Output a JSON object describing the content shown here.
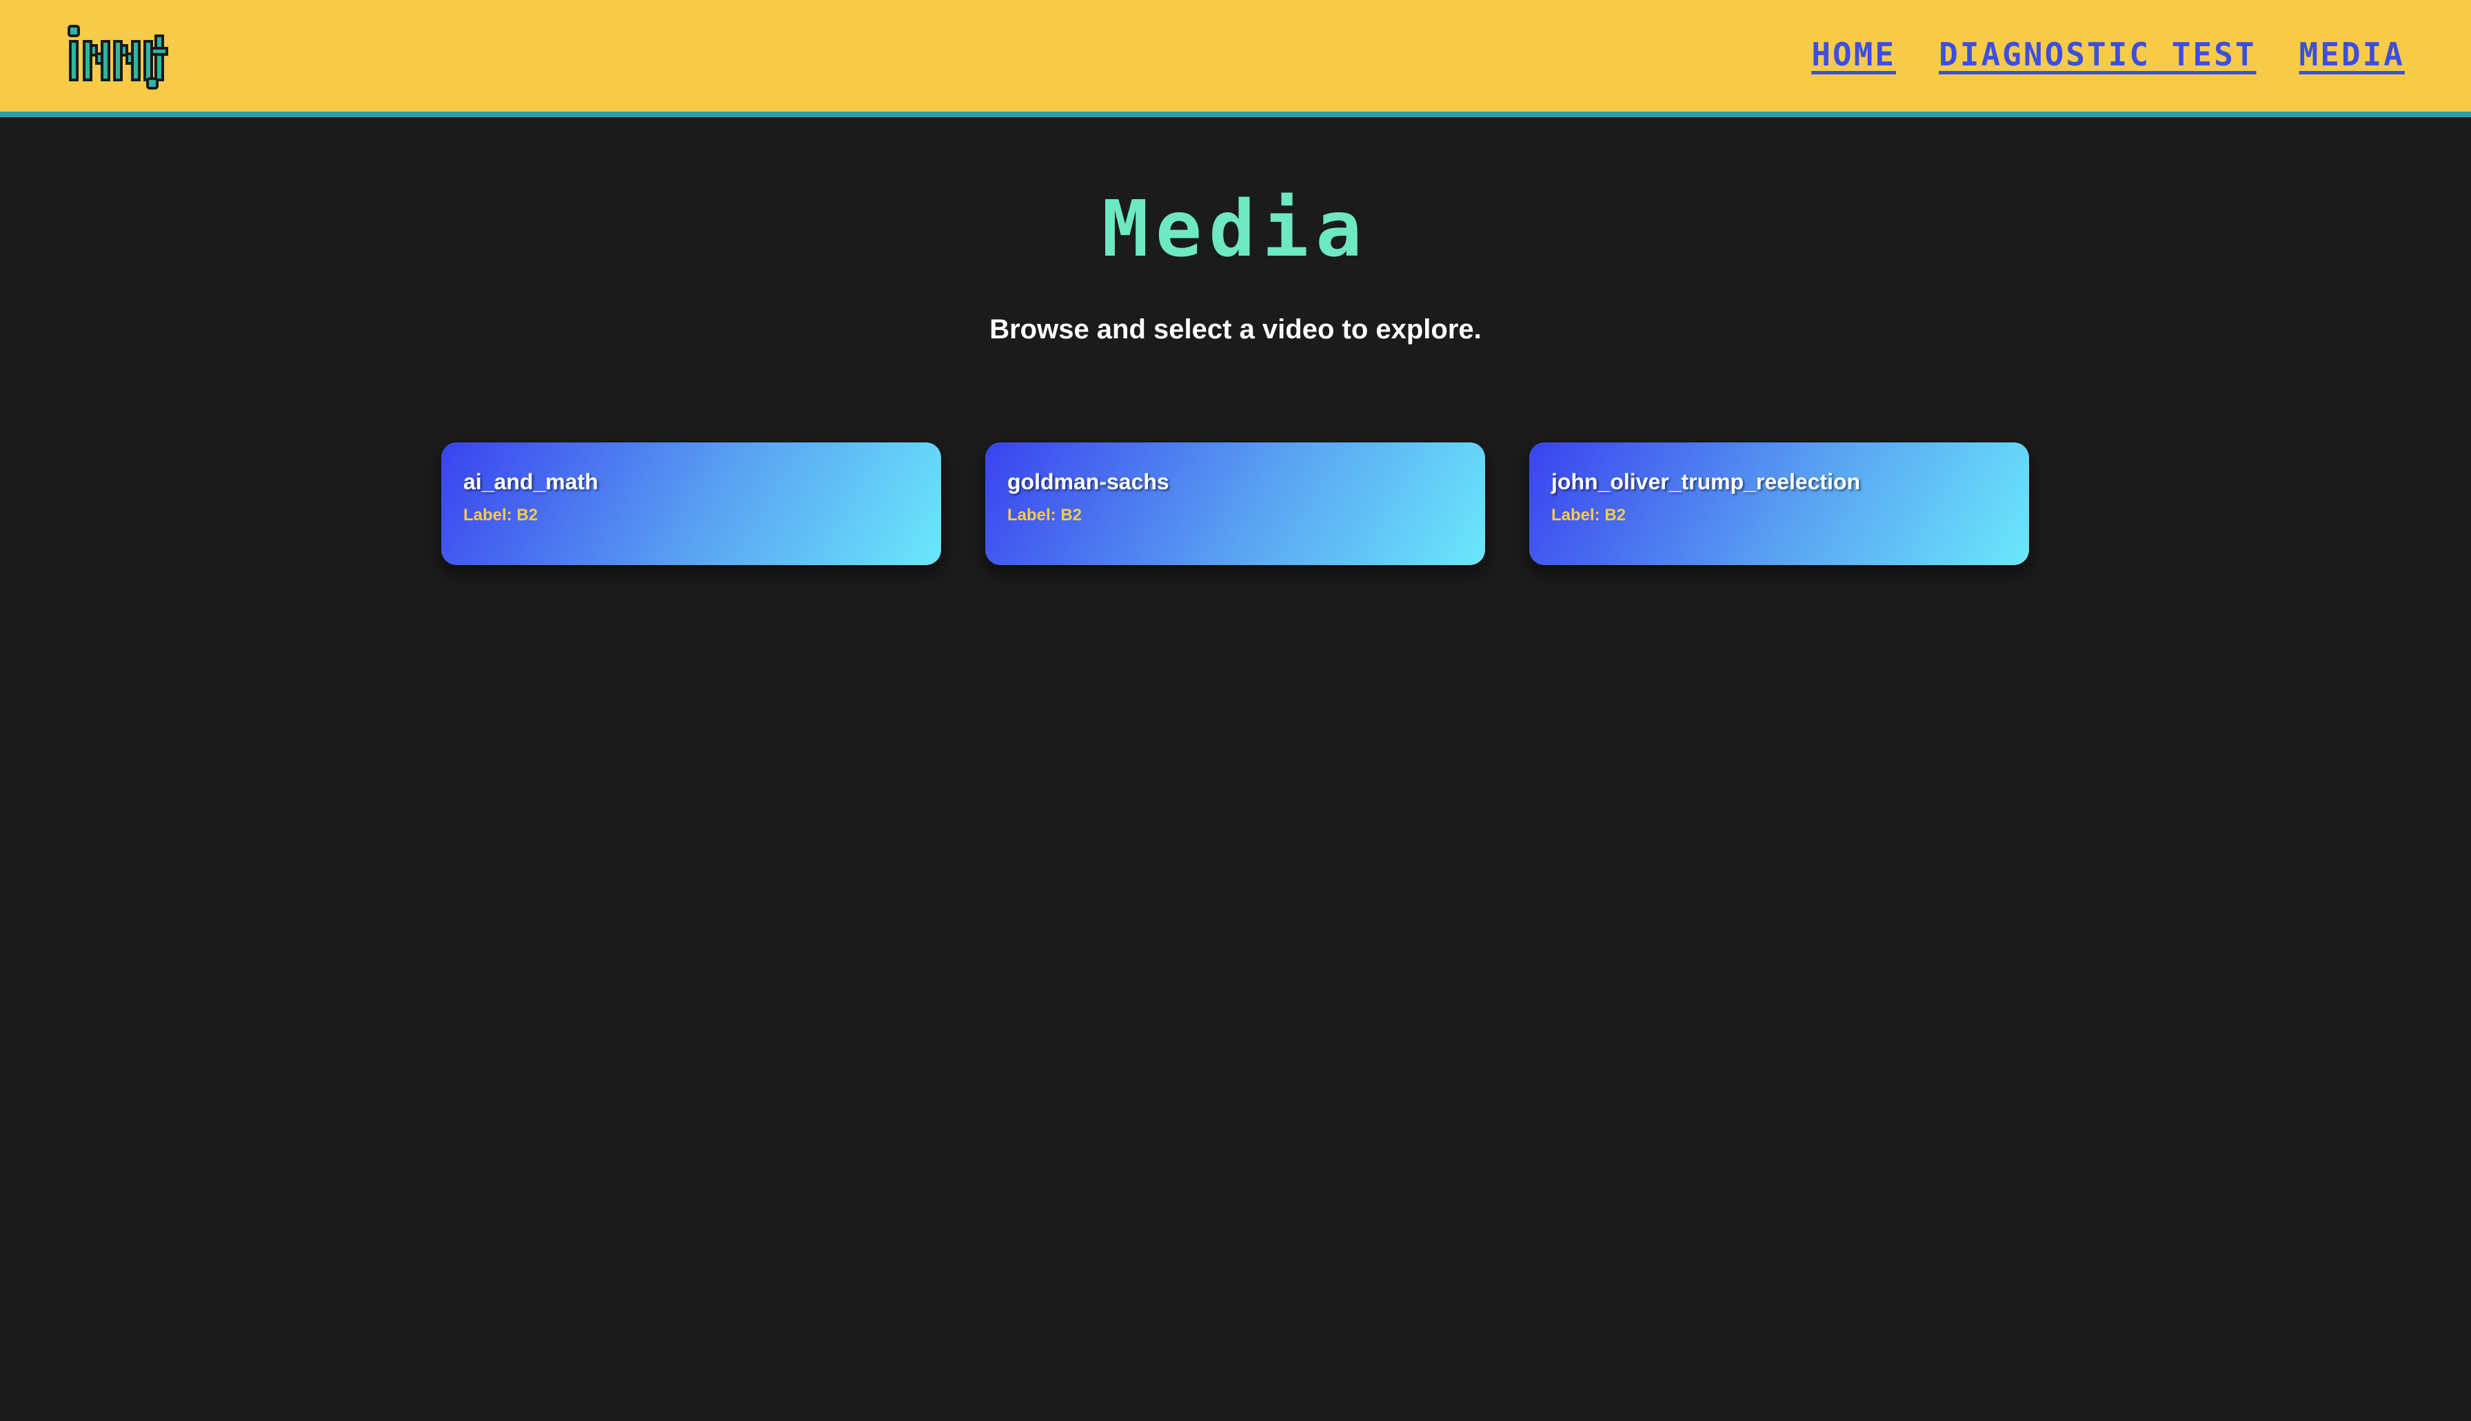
{
  "brand": {
    "logo_text": "innit",
    "logo_icon": "innit-pixel-logo"
  },
  "nav": {
    "items": [
      {
        "label": "HOME"
      },
      {
        "label": "DIAGNOSTIC TEST"
      },
      {
        "label": "MEDIA"
      }
    ]
  },
  "page": {
    "title": "Media",
    "subtitle": "Browse and select a video to explore."
  },
  "videos": [
    {
      "title": "ai_and_math",
      "label": "Label: B2"
    },
    {
      "title": "goldman-sachs",
      "label": "Label: B2"
    },
    {
      "title": "john_oliver_trump_reelection",
      "label": "Label: B2"
    }
  ],
  "colors": {
    "header_bg": "#f7cb48",
    "header_border": "#2aa0a8",
    "page_bg": "#1b1b1b",
    "nav_link": "#3c4fe0",
    "title": "#6de8c2",
    "card_gradient_start": "#3a43ef",
    "card_gradient_end": "#6ae8fb",
    "card_label": "#f7cb48"
  }
}
